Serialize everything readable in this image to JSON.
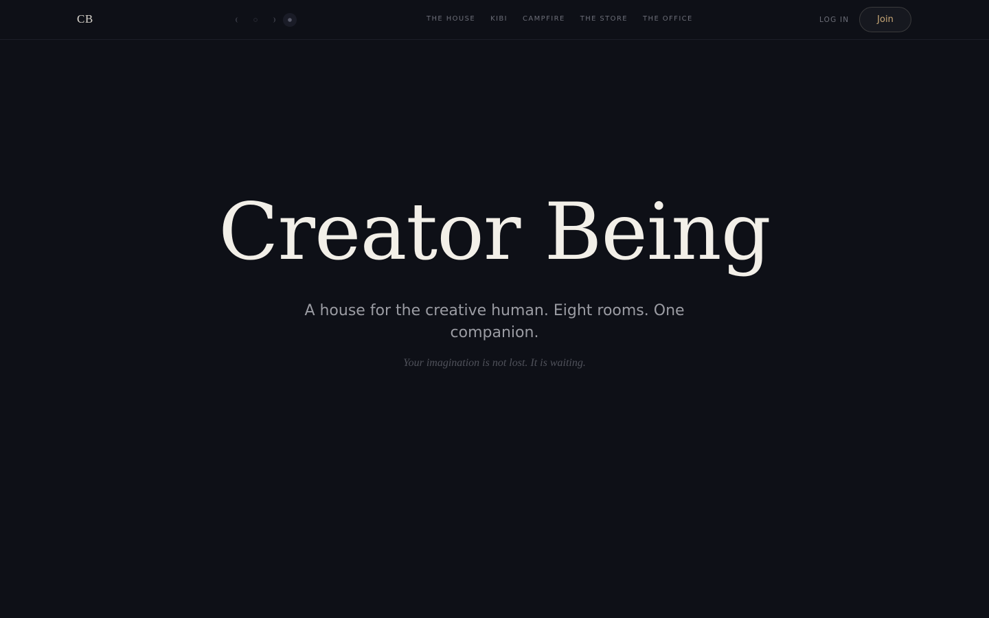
{
  "header": {
    "logo": "CB",
    "phases": [
      {
        "icon": "waning-moon-icon",
        "active": false
      },
      {
        "icon": "new-moon-icon",
        "active": false
      },
      {
        "icon": "waxing-moon-icon",
        "active": false
      },
      {
        "icon": "full-moon-icon",
        "active": true
      }
    ],
    "nav": [
      {
        "label": "THE HOUSE"
      },
      {
        "label": "KIBI"
      },
      {
        "label": "CAMPFIRE"
      },
      {
        "label": "THE STORE"
      },
      {
        "label": "THE OFFICE"
      }
    ],
    "login_label": "LOG IN",
    "join_label": "Join"
  },
  "hero": {
    "title": "Creator Being",
    "subtitle": "A house for the creative human. Eight rooms. One companion.",
    "tagline": "Your imagination is not lost. It is waiting."
  },
  "colors": {
    "background": "#0e1017",
    "accent": "#c9a877",
    "title": "#f2efe8",
    "muted": "#6c6e78"
  }
}
